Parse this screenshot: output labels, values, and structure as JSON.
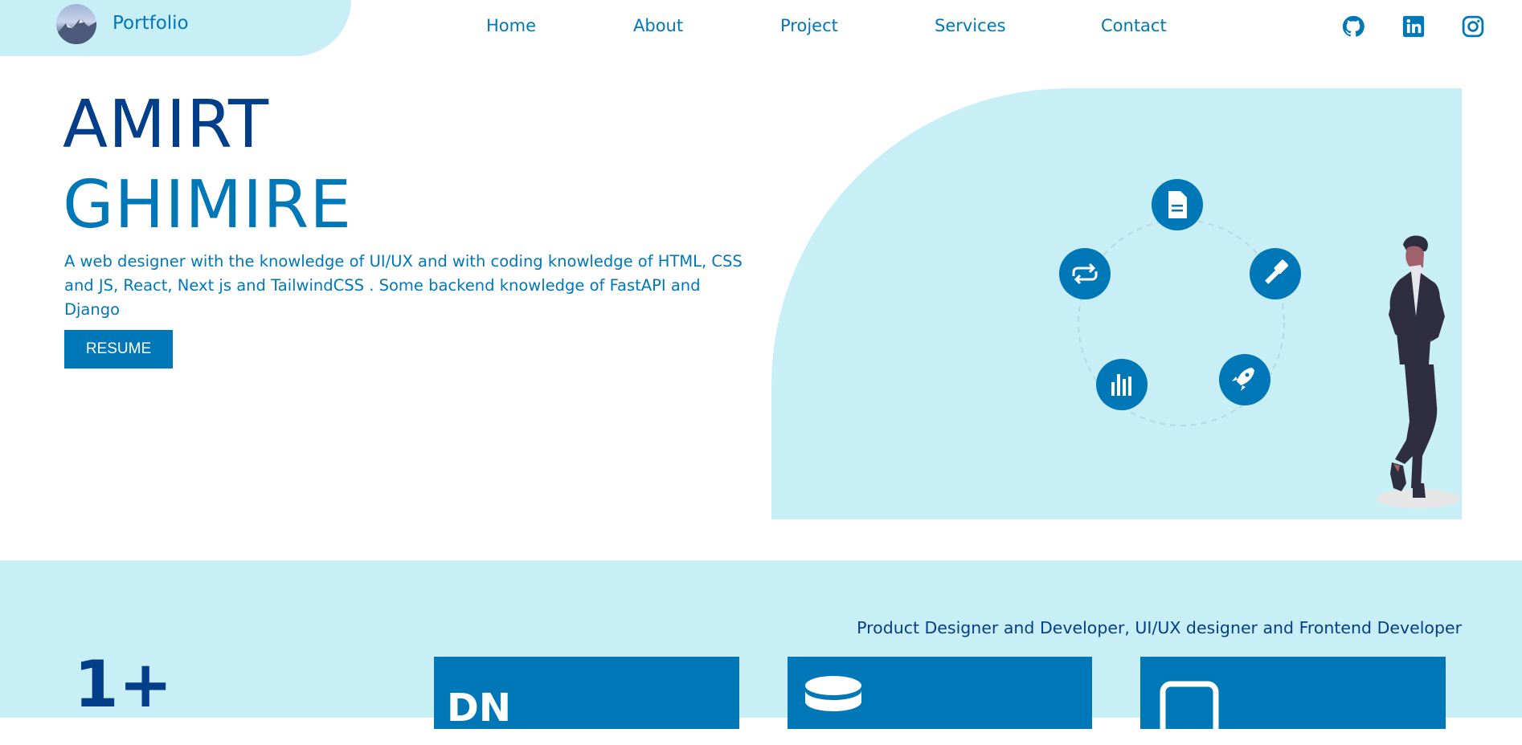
{
  "nav": {
    "brand": "Portfolio",
    "links": [
      "Home",
      "About",
      "Project",
      "Services",
      "Contact"
    ],
    "social": [
      "github-icon",
      "linkedin-icon",
      "instagram-icon"
    ]
  },
  "hero": {
    "first_name": "AMIRT",
    "last_name": "GHIMIRE",
    "description": "A web designer with the knowledge of UI/UX and with coding knowledge of HTML, CSS and JS, React, Next js and TailwindCSS . Some backend knowledge of FastAPI and Django",
    "resume_label": "RESUME",
    "illustration_icons": [
      "document-icon",
      "hammer-icon",
      "rocket-icon",
      "bar-chart-icon",
      "repeat-icon"
    ]
  },
  "about": {
    "tagline": "Product Designer and Developer, UI/UX designer and Frontend Developer",
    "stat_value": "1+",
    "cards": [
      {
        "icon": "dn-text",
        "text": "DN"
      },
      {
        "icon": "database-icon",
        "text": ""
      },
      {
        "icon": "device-icon",
        "text": ""
      }
    ]
  },
  "colors": {
    "primary": "#0077b6",
    "dark": "#023e8a",
    "light_bg": "#c9eff6",
    "white": "#ffffff"
  }
}
